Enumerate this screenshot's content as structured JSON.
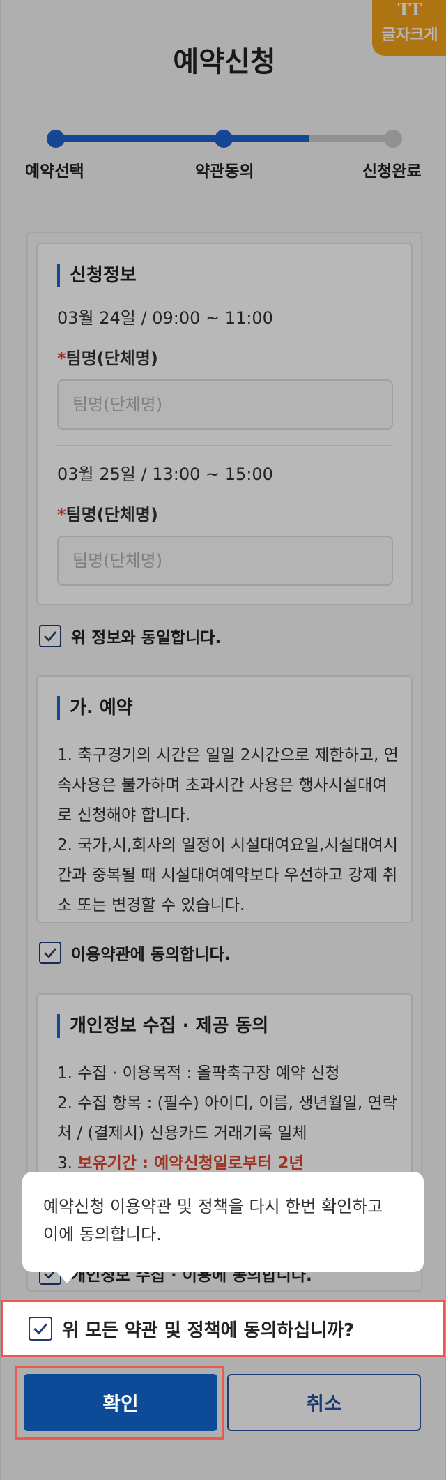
{
  "font_size_button": {
    "icon": "text-size-icon",
    "label": "글자크게"
  },
  "title": "예약신청",
  "stepper": {
    "steps": [
      "예약선택",
      "약관동의",
      "신청완료"
    ],
    "current_step": 2,
    "active_color": "#1e63cf"
  },
  "info": {
    "section_title": "신청정보",
    "slots": [
      {
        "datetime": "03월 24일 / 09:00 ~ 11:00",
        "field_label": "팀명(단체명)",
        "placeholder": "팀명(단체명)",
        "value": ""
      },
      {
        "datetime": "03월 25일 / 13:00 ~ 15:00",
        "field_label": "팀명(단체명)",
        "placeholder": "팀명(단체명)",
        "value": ""
      }
    ],
    "required_mark": "*"
  },
  "same_info_check": {
    "label": "위 정보와 동일합니다.",
    "checked": true
  },
  "terms": {
    "section_title": "가. 예약",
    "lines": [
      "1. 축구경기의 시간은 일일 2시간으로 제한하고, 연",
      "속사용은 불가하며 초과시간 사용은 행사시설대여",
      "로 신청해야 합니다.",
      "2. 국가,시,회사의 일정이 시설대여요일,시설대여시",
      "간과 중복될 때 시설대여예약보다 우선하고 강제 취",
      "소 또는 변경할 수 있습니다."
    ]
  },
  "terms_check": {
    "label": "이용약관에 동의합니다.",
    "checked": true
  },
  "privacy": {
    "section_title": "개인정보 수집 · 제공 동의",
    "lines": [
      "1. 수집 · 이용목적 : 올팍축구장 예약 신청",
      "2. 수집 항목 : (필수) 아이디, 이름, 생년월일, 연락",
      "처 / (결제시) 신용카드 거래기록 일체"
    ],
    "retention_prefix": "3. ",
    "retention": "보유기간 : 예약신청일로부터 2년"
  },
  "privacy_check": {
    "label": "개인정보 수집 · 이용에 동의합니다.",
    "checked": true
  },
  "tooltip": {
    "line1": "예약신청 이용약관 및 정책을 다시 한번 확인하고",
    "line2": "이에 동의합니다."
  },
  "agree_all": {
    "label": "위 모든 약관 및 정책에 동의하십니까?",
    "checked": true
  },
  "buttons": {
    "confirm": "확인",
    "cancel": "취소"
  },
  "colors": {
    "primary": "#0d4a98",
    "highlight": "#ec5a4f",
    "accent": "#f2a11a"
  }
}
